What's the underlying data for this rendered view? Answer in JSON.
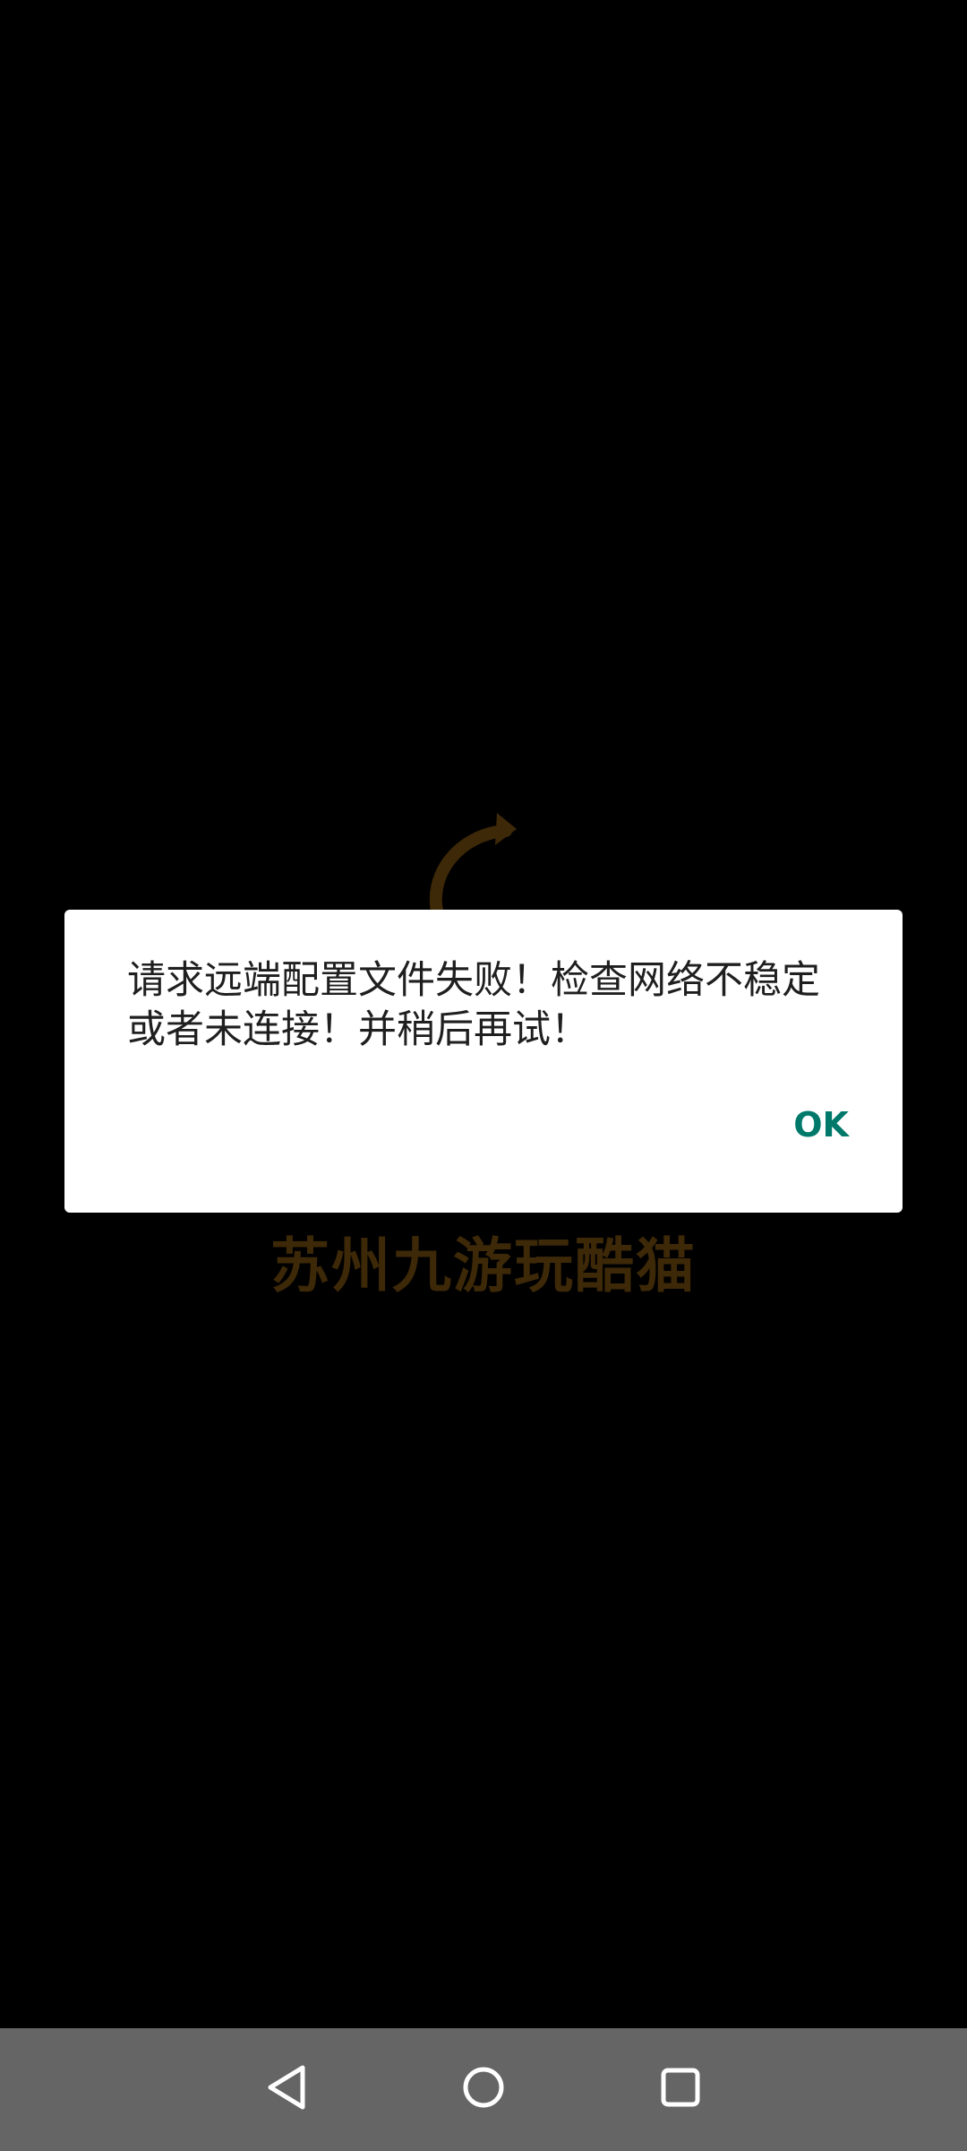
{
  "splash": {
    "brand_text": "苏州九游玩酷猫",
    "logo_icon": "curved-arrow-logo-icon",
    "brand_color": "#6f4a10"
  },
  "dialog": {
    "message": "请求远端配置文件失败！检查网络不稳定或者未连接！并稍后再试！",
    "ok_label": "OK",
    "accent_color": "#00796b"
  },
  "navbar": {
    "back_icon": "back-triangle-icon",
    "home_icon": "home-circle-icon",
    "recents_icon": "recents-square-icon",
    "background_color": "#656565"
  }
}
